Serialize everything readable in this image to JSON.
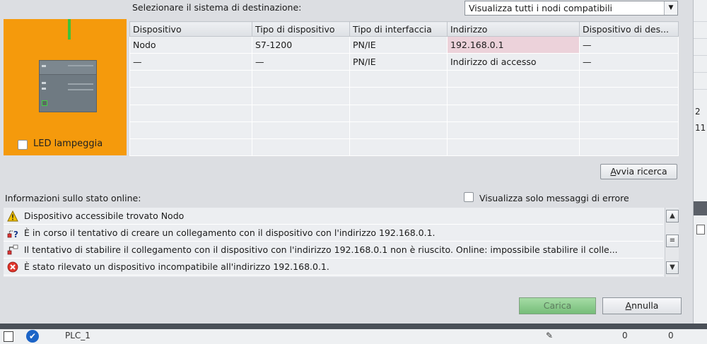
{
  "target": {
    "label": "Selezionare il sistema di destinazione:",
    "selected": "Visualizza tutti i nodi compatibili"
  },
  "device_panel": {
    "led_label": "LED lampeggia"
  },
  "device_table": {
    "headers": [
      "Dispositivo",
      "Tipo di dispositivo",
      "Tipo di interfaccia",
      "Indirizzo",
      "Dispositivo di des..."
    ],
    "rows": [
      [
        "Nodo",
        "S7-1200",
        "PN/IE",
        "192.168.0.1",
        "—"
      ],
      [
        "—",
        "—",
        "PN/IE",
        "Indirizzo di accesso",
        "—"
      ]
    ]
  },
  "search_button": {
    "label_pre": "",
    "label_ul": "A",
    "label_post": "vvia ricerca"
  },
  "status": {
    "label": "Informazioni sullo stato online:",
    "error_only_label": "Visualizza solo messaggi di errore",
    "messages": [
      {
        "icon": "warning-icon",
        "text": "Dispositivo accessibile trovato Nodo"
      },
      {
        "icon": "connect-question-icon",
        "text": "È in corso il tentativo di creare un collegamento con il dispositivo con l'indirizzo 192.168.0.1."
      },
      {
        "icon": "connect-failed-icon",
        "text": "Il tentativo di stabilire il collegamento con il dispositivo con l'indirizzo 192.168.0.1 non è riuscito. Online: impossibile stabilire il colle..."
      },
      {
        "icon": "error-icon",
        "text": "È stato rilevato un dispositivo incompatibile all'indirizzo 192.168.0.1."
      }
    ]
  },
  "buttons": {
    "load": "Carica",
    "cancel_ul": "A",
    "cancel_rest": "nnulla"
  },
  "background": {
    "plc_name": "PLC_1",
    "right_values": [
      "2",
      "11"
    ],
    "zero": "0"
  },
  "colors": {
    "device_panel": "#f59a0c",
    "link_line": "#3ec23a",
    "address_highlight": "#ecd2da",
    "load_button": "#8fce8f"
  }
}
